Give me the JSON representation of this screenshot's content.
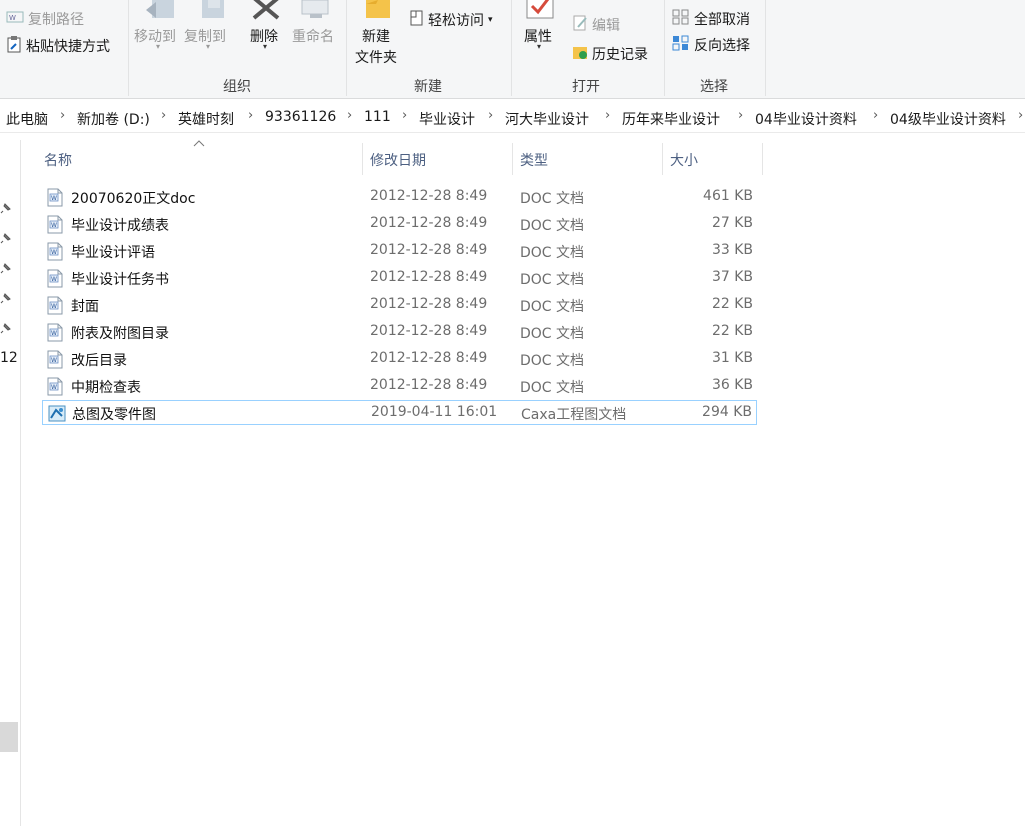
{
  "ribbon": {
    "clipboard": {
      "copy_path": "复制路径",
      "paste_shortcut": "粘贴快捷方式"
    },
    "organize": {
      "move_to": "移动到",
      "copy_to": "复制到",
      "delete": "删除",
      "rename": "重命名",
      "group_label": "组织"
    },
    "new": {
      "new_folder_line1": "新建",
      "new_folder_line2": "文件夹",
      "easy_access": "轻松访问",
      "group_label": "新建"
    },
    "open": {
      "properties": "属性",
      "edit": "编辑",
      "history": "历史记录",
      "group_label": "打开"
    },
    "select": {
      "select_none": "全部取消",
      "invert_selection": "反向选择",
      "group_label": "选择"
    }
  },
  "breadcrumb": [
    "此电脑",
    "新加卷 (D:)",
    "英雄时刻",
    "93361126",
    "111",
    "毕业设计",
    "河大毕业设计",
    "历年来毕业设计",
    "04毕业设计资料",
    "04级毕业设计资料"
  ],
  "nav_pane": {
    "number_label": "12"
  },
  "columns": {
    "name": "名称",
    "modified": "修改日期",
    "type": "类型",
    "size": "大小"
  },
  "files": [
    {
      "name": "20070620正文doc",
      "date": "2012-12-28 8:49",
      "type": "DOC 文档",
      "size": "461 KB",
      "icon": "word-doc-icon"
    },
    {
      "name": "毕业设计成绩表",
      "date": "2012-12-28 8:49",
      "type": "DOC 文档",
      "size": "27 KB",
      "icon": "word-doc-icon"
    },
    {
      "name": "毕业设计评语",
      "date": "2012-12-28 8:49",
      "type": "DOC 文档",
      "size": "33 KB",
      "icon": "word-doc-icon"
    },
    {
      "name": "毕业设计任务书",
      "date": "2012-12-28 8:49",
      "type": "DOC 文档",
      "size": "37 KB",
      "icon": "word-doc-icon"
    },
    {
      "name": "封面",
      "date": "2012-12-28 8:49",
      "type": "DOC 文档",
      "size": "22 KB",
      "icon": "word-doc-icon"
    },
    {
      "name": "附表及附图目录",
      "date": "2012-12-28 8:49",
      "type": "DOC 文档",
      "size": "22 KB",
      "icon": "word-doc-icon"
    },
    {
      "name": "改后目录",
      "date": "2012-12-28 8:49",
      "type": "DOC 文档",
      "size": "31 KB",
      "icon": "word-doc-icon"
    },
    {
      "name": "中期检查表",
      "date": "2012-12-28 8:49",
      "type": "DOC 文档",
      "size": "36 KB",
      "icon": "word-doc-icon"
    },
    {
      "name": "总图及零件图",
      "date": "2019-04-11 16:01",
      "type": "Caxa工程图文档",
      "size": "294 KB",
      "icon": "caxa-drawing-icon",
      "selected": true
    }
  ],
  "colors": {
    "selection_border": "#99d1ff",
    "header_text": "#4d6082",
    "ribbon_bg": "#f5f6f7"
  }
}
